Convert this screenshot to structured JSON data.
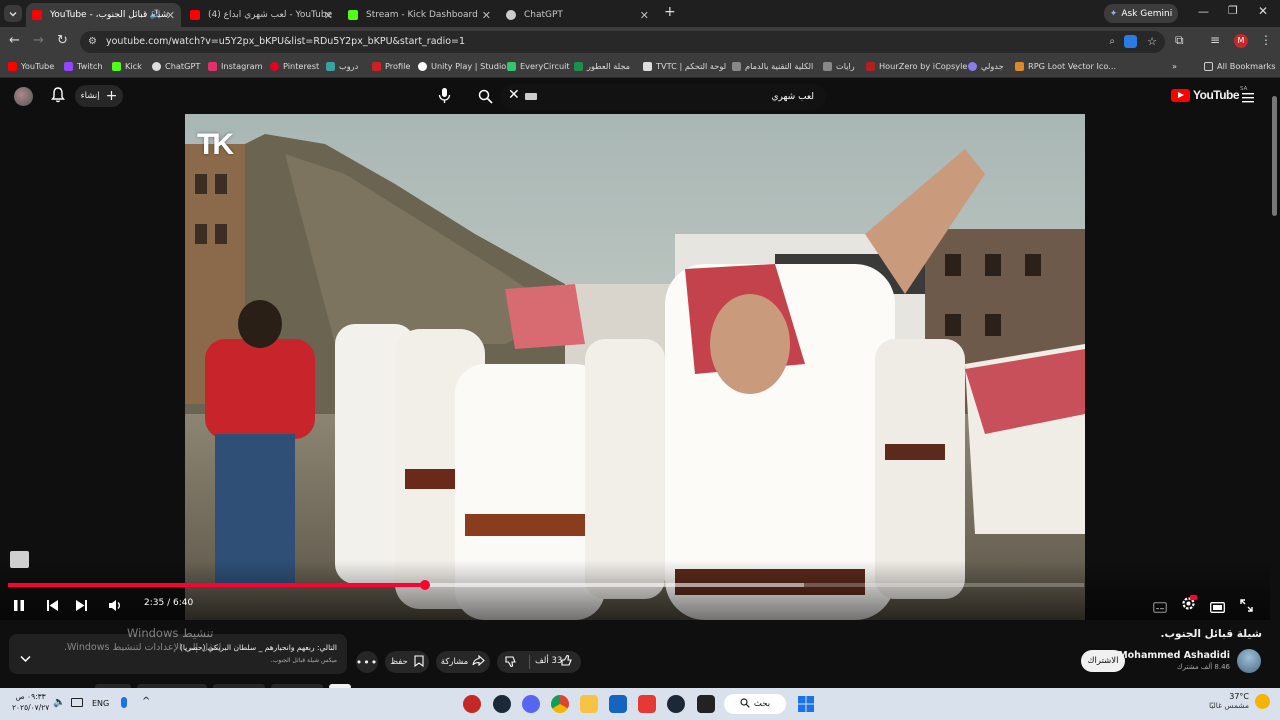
{
  "browser": {
    "tabs": [
      {
        "label": "شيلة قبائل الجنوب، - YouTube",
        "icon": "youtube-icon",
        "active": true
      },
      {
        "label": "(4) لعب شهري ابداع - YouTube",
        "icon": "youtube-icon",
        "active": false
      },
      {
        "label": "Stream - Kick Dashboard",
        "icon": "kick-icon",
        "active": false
      },
      {
        "label": "ChatGPT",
        "icon": "chatgpt-icon",
        "active": false
      }
    ],
    "ask_gemini": "Ask Gemini",
    "url": "youtube.com/watch?v=u5Y2px_bKPU&list=RDu5Y2px_bKPU&start_radio=1",
    "bookmarks": [
      {
        "label": "YouTube",
        "icon": "youtube-icon",
        "color": "#ff0000"
      },
      {
        "label": "Twitch",
        "icon": "twitch-icon",
        "color": "#9146ff"
      },
      {
        "label": "Kick",
        "icon": "kick-icon",
        "color": "#53fc18"
      },
      {
        "label": "ChatGPT",
        "icon": "chatgpt-icon",
        "color": "#dddddd"
      },
      {
        "label": "Instagram",
        "icon": "instagram-icon",
        "color": "#e1306c"
      },
      {
        "label": "Pinterest",
        "icon": "pinterest-icon",
        "color": "#e60023"
      },
      {
        "label": "دروب",
        "icon": "droob-icon",
        "color": "#3aa0a0"
      },
      {
        "label": "Profile",
        "icon": "profile-icon",
        "color": "#cc2222"
      },
      {
        "label": "Unity Play | Studio",
        "icon": "unity-icon",
        "color": "#ffffff"
      },
      {
        "label": "EveryCircuit",
        "icon": "everycircuit-icon",
        "color": "#35c46a"
      },
      {
        "label": "مجلة العطور",
        "icon": "perfume-icon",
        "color": "#1d8f4a"
      },
      {
        "label": "TVTC | لوحة التحكم",
        "icon": "tvtc-icon",
        "color": "#dddddd"
      },
      {
        "label": "الكلية التقنية بالدمام",
        "icon": "college-icon",
        "color": "#888888"
      },
      {
        "label": "رايات",
        "icon": "rayat-icon",
        "color": "#888888"
      },
      {
        "label": "HourZero by iCopsyle",
        "icon": "hourzero-icon",
        "color": "#b02020"
      },
      {
        "label": "جدولي",
        "icon": "schedule-icon",
        "color": "#8b7cf0"
      },
      {
        "label": "RPG Loot Vector Ico...",
        "icon": "rpg-icon",
        "color": "#d98a2b"
      }
    ],
    "all_bookmarks": "All Bookmarks"
  },
  "youtube": {
    "create_label": "إنشاء",
    "search_value": "لعب شهري",
    "logo_text": "YouTube",
    "region": "SA",
    "watermark": "TK",
    "time_display": "2:35 / 6:40",
    "progress": 0.3875,
    "buffered": 0.74,
    "video_title": "شيلة قبائل الجنوب.",
    "channel_name": "Mohammed Ashadidi",
    "subscribers": "8.46 ألف مشترك",
    "subscribe_label": "الاشتراك",
    "likes": "33 ألف",
    "share_label": "مشاركة",
    "save_label": "حفظ",
    "next_title": "التالي: ربعهم وانحبارهم _ سلطان البريكي (حصريا)",
    "next_sub": "ميكس شيلة قبائل الجنوب.",
    "activate_title": "تنشيط Windows",
    "activate_sub": "انتقل إلى الإعدادات لتنشيط Windows."
  },
  "taskbar": {
    "weather_temp": "37°C",
    "weather_desc": "مشمس غالبًا",
    "search_label": "بحث",
    "lang": "ENG",
    "time": "٠٩:٣٣ ص",
    "date": "٢٠٢٥/٠٧/٢٧"
  }
}
